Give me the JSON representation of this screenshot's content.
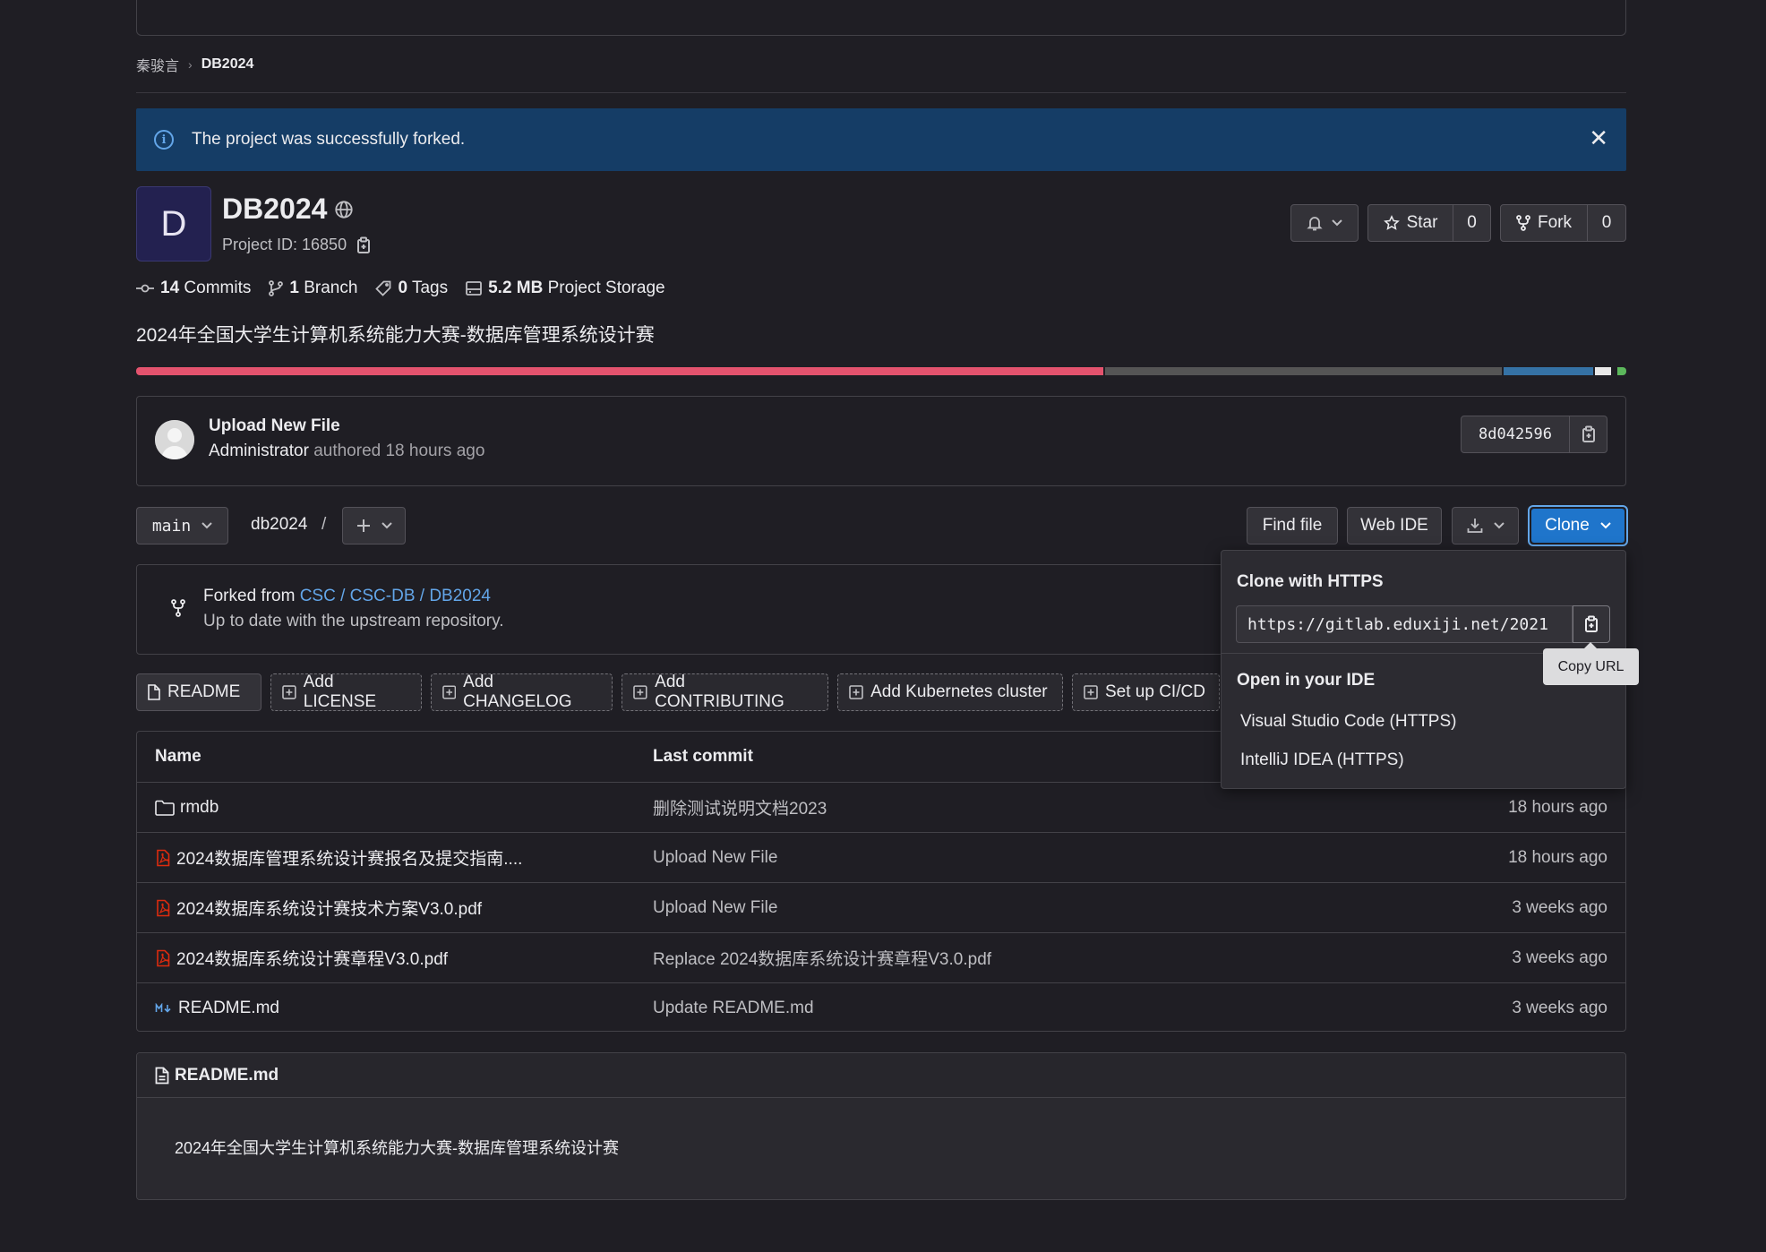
{
  "breadcrumb": {
    "owner": "秦骏言",
    "project": "DB2024"
  },
  "alert": {
    "message": "The project was successfully forked."
  },
  "project": {
    "avatar_letter": "D",
    "name": "DB2024",
    "id_label": "Project ID: 16850",
    "description": "2024年全国大学生计算机系统能力大赛-数据库管理系统设计赛"
  },
  "actions": {
    "star_label": "Star",
    "star_count": "0",
    "fork_label": "Fork",
    "fork_count": "0"
  },
  "stats": {
    "commits_num": "14",
    "commits_label": "Commits",
    "branch_num": "1",
    "branch_label": "Branch",
    "tags_num": "0",
    "tags_label": "Tags",
    "storage_num": "5.2 MB",
    "storage_label": "Project Storage"
  },
  "language_bar": [
    {
      "color": "#e4536e",
      "fraction": 0.653
    },
    {
      "color": "#555555",
      "fraction": 0.268
    },
    {
      "color": "#3572a5",
      "fraction": 0.06
    },
    {
      "color": "#e8e8e8",
      "fraction": 0.011
    },
    {
      "color": "#1f1e24",
      "fraction": 0.002
    },
    {
      "color": "#5cb85c",
      "fraction": 0.006
    }
  ],
  "last_commit": {
    "title": "Upload New File",
    "author": "Administrator",
    "meta": "authored 18 hours ago",
    "sha": "8d042596"
  },
  "toolbar": {
    "branch": "main",
    "path": "db2024",
    "path_sep": "/",
    "find_file": "Find file",
    "web_ide": "Web IDE",
    "clone": "Clone"
  },
  "fork_info": {
    "prefix": "Forked from",
    "source": "CSC / CSC-DB / DB2024",
    "status": "Up to date with the upstream repository."
  },
  "readme_buttons": [
    "README",
    "Add LICENSE",
    "Add CHANGELOG",
    "Add CONTRIBUTING",
    "Add Kubernetes cluster",
    "Set up CI/CD"
  ],
  "file_table": {
    "headers": {
      "name": "Name",
      "last_commit": "Last commit"
    },
    "rows": [
      {
        "name": "rmdb",
        "icon": "folder-icon",
        "commit": "删除测试说明文档2023",
        "date": "18 hours ago"
      },
      {
        "name": "2024数据库管理系统设计赛报名及提交指南....",
        "icon": "pdf-icon",
        "commit": "Upload New File",
        "date": "18 hours ago"
      },
      {
        "name": "2024数据库系统设计赛技术方案V3.0.pdf",
        "icon": "pdf-icon",
        "commit": "Upload New File",
        "date": "3 weeks ago"
      },
      {
        "name": "2024数据库系统设计赛章程V3.0.pdf",
        "icon": "pdf-icon",
        "commit": "Replace 2024数据库系统设计赛章程V3.0.pdf",
        "date": "3 weeks ago"
      },
      {
        "name": "README.md",
        "icon": "markdown-icon",
        "commit": "Update README.md",
        "date": "3 weeks ago"
      }
    ]
  },
  "readme": {
    "filename": "README.md",
    "content": "2024年全国大学生计算机系统能力大赛-数据库管理系统设计赛"
  },
  "clone_dropdown": {
    "https_heading": "Clone with HTTPS",
    "https_url": "https://gitlab.eduxiji.net/2021",
    "ide_heading": "Open in your IDE",
    "ide_options": [
      "Visual Studio Code (HTTPS)",
      "IntelliJ IDEA (HTTPS)"
    ],
    "tooltip": "Copy URL"
  },
  "colors": {
    "background": "#1f1e24",
    "accent": "#1f75cb",
    "link": "#63a6e9",
    "alert_bg": "#153d66"
  }
}
